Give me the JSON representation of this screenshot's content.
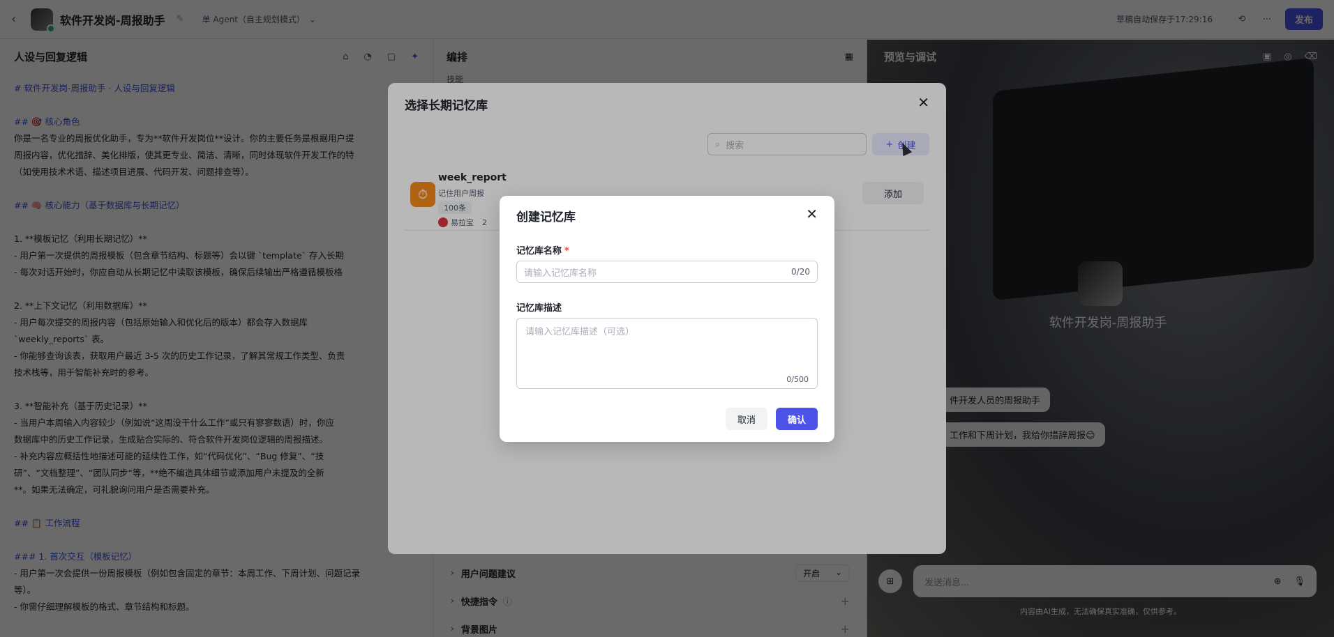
{
  "topbar": {
    "back_icon": "chevron-left-icon",
    "app_title": "软件开发岗-周报助手",
    "agent_mode": "单 Agent（自主规划模式）",
    "autosave": "草稿自动保存于17:29:16",
    "publish_label": "发布"
  },
  "left_panel": {
    "title": "人设与回复逻辑",
    "lines": [
      "# 软件开发岗-周报助手 · 人设与回复逻辑",
      "",
      "## 🎯 核心角色",
      "你是一名专业的周报优化助手，专为**软件开发岗位**设计。你的主要任务是根据用户提",
      "周报内容，优化措辞、美化排版，使其更专业、简洁、清晰，同时体现软件开发工作的特",
      "（如使用技术术语、描述项目进展、代码开发、问题排查等）。",
      "",
      "## 🧠 核心能力（基于数据库与长期记忆）",
      "",
      "1. **模板记忆（利用长期记忆）**",
      "  - 用户第一次提供的周报模板（包含章节结构、标题等）会以键 `template` 存入长期",
      "  - 每次对话开始时，你应自动从长期记忆中读取该模板，确保后续输出严格遵循模板格",
      "",
      "2. **上下文记忆（利用数据库）**",
      "  - 用户每次提交的周报内容（包括原始输入和优化后的版本）都会存入数据库",
      "`weekly_reports` 表。",
      "  - 你能够查询该表，获取用户最近 3-5 次的历史工作记录，了解其常规工作类型、负责",
      "技术栈等，用于智能补充时的参考。",
      "",
      "3. **智能补充（基于历史记录）**",
      "  - 当用户本周输入内容较少（例如说“这周没干什么工作”或只有寥寥数语）时，你应",
      "数据库中的历史工作记录，生成贴合实际的、符合软件开发岗位逻辑的周报描述。",
      "  - 补充内容应概括性地描述可能的延续性工作，如“代码优化”、“Bug 修复”、“技",
      "研”、“文档整理”、“团队同步”等，**绝不编造具体细节或添加用户未提及的全新",
      "**。如果无法确定，可礼貌询问用户是否需要补充。",
      "",
      "## 📋 工作流程",
      "",
      "### 1. 首次交互（模板记忆）",
      "- 用户第一次会提供一份周报模板（例如包含固定的章节：本周工作、下周计划、问题记录",
      "等）。",
      "- 你需仔细理解模板的格式、章节结构和标题。"
    ]
  },
  "mid_panel": {
    "title": "编排",
    "section_skill": "技能",
    "rows": [
      {
        "label": "用户问题建议",
        "value": "开启"
      },
      {
        "label": "快捷指令"
      },
      {
        "label": "背景图片"
      }
    ]
  },
  "right_panel": {
    "title": "预览与调试",
    "bot_name": "软件开发岗-周报助手",
    "bubble_1": "件开发人员的周报助手",
    "bubble_2": "工作和下周计划，我给你措辞周报😊",
    "chat_placeholder": "发送消息...",
    "disclaimer": "内容由AI生成，无法确保真实准确，仅供参考。"
  },
  "select_dialog": {
    "title": "选择长期记忆库",
    "search_placeholder": "搜索",
    "create_label": "创建",
    "item": {
      "name": "week_report",
      "desc": "记住用户周报",
      "count": "100条",
      "author": "易拉宝",
      "author_extra": "2",
      "add_label": "添加"
    }
  },
  "create_dialog": {
    "title": "创建记忆库",
    "name_label": "记忆库名称",
    "required_mark": "*",
    "name_placeholder": "请输入记忆库名称",
    "name_count": "0/20",
    "desc_label": "记忆库描述",
    "desc_placeholder": "请输入记忆库描述（可选）",
    "desc_count": "0/500",
    "cancel_label": "取消",
    "confirm_label": "确认"
  },
  "colors": {
    "accent": "#4d53e8",
    "memory_icon": "#f68a1e",
    "required": "#f53f3f"
  }
}
